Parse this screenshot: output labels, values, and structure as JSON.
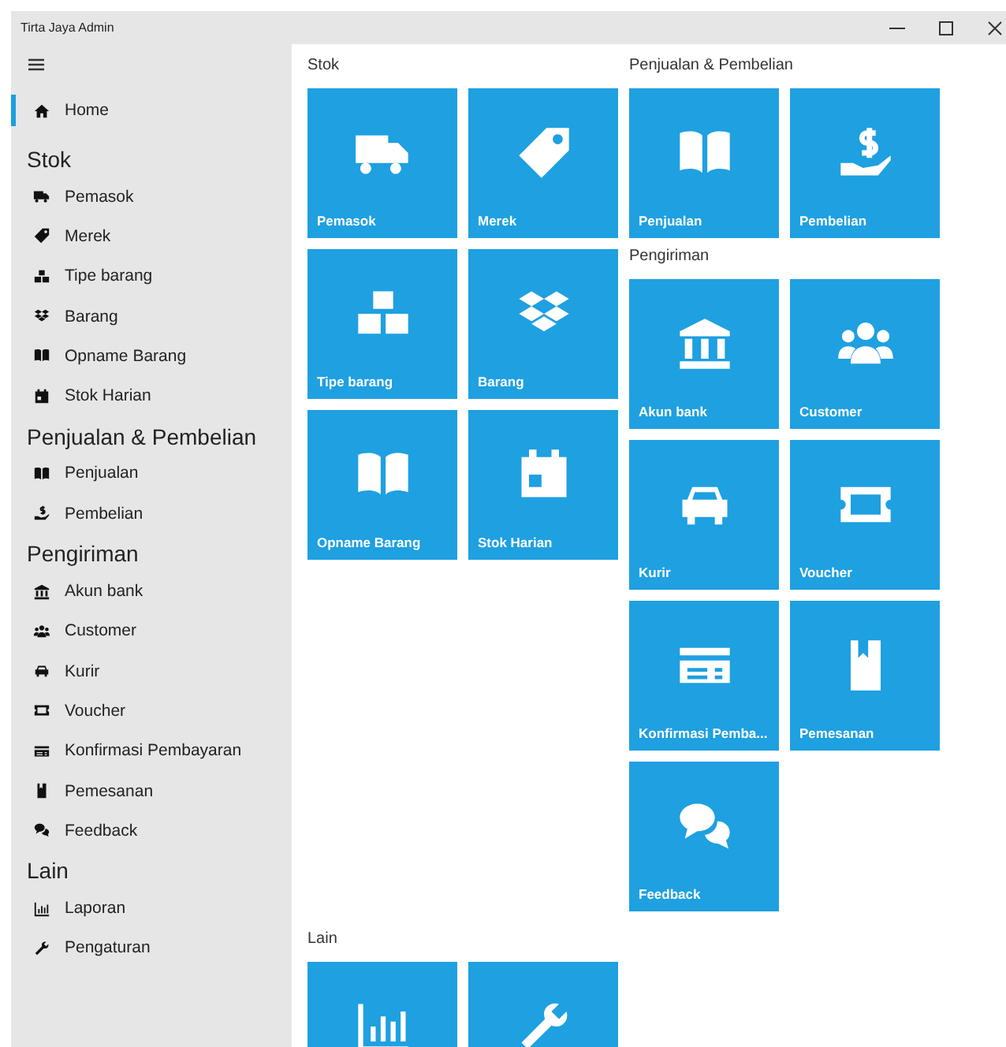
{
  "window": {
    "title": "Tirta Jaya Admin"
  },
  "sidebar": {
    "home": {
      "label": "Home",
      "selected": true
    },
    "sections": [
      {
        "title": "Stok",
        "items": [
          {
            "label": "Pemasok",
            "selected": false
          },
          {
            "label": "Merek",
            "selected": false
          },
          {
            "label": "Tipe barang",
            "selected": false
          },
          {
            "label": "Barang",
            "selected": false
          },
          {
            "label": "Opname Barang",
            "selected": false
          },
          {
            "label": "Stok Harian",
            "selected": false
          }
        ]
      },
      {
        "title": "Penjualan & Pembelian",
        "items": [
          {
            "label": "Penjualan",
            "selected": false
          },
          {
            "label": "Pembelian",
            "selected": false
          }
        ]
      },
      {
        "title": "Pengiriman",
        "items": [
          {
            "label": "Akun bank",
            "selected": false
          },
          {
            "label": "Customer",
            "selected": false
          },
          {
            "label": "Kurir",
            "selected": false
          },
          {
            "label": "Voucher",
            "selected": false
          },
          {
            "label": "Konfirmasi Pembayaran",
            "selected": false
          },
          {
            "label": "Pemesanan",
            "selected": false
          },
          {
            "label": "Feedback",
            "selected": false
          }
        ]
      },
      {
        "title": "Lain",
        "items": [
          {
            "label": "Laporan",
            "selected": false
          },
          {
            "label": "Pengaturan",
            "selected": false
          }
        ]
      }
    ]
  },
  "tiles": {
    "sections": [
      {
        "title": "Stok",
        "tiles": [
          {
            "label": "Pemasok"
          },
          {
            "label": "Merek"
          },
          {
            "label": "Tipe barang"
          },
          {
            "label": "Barang"
          },
          {
            "label": "Opname Barang"
          },
          {
            "label": "Stok Harian"
          }
        ]
      },
      {
        "title": "Penjualan & Pembelian",
        "tiles": [
          {
            "label": "Penjualan"
          },
          {
            "label": "Pembelian"
          }
        ]
      },
      {
        "title": "Pengiriman",
        "tiles": [
          {
            "label": "Akun bank"
          },
          {
            "label": "Customer"
          },
          {
            "label": "Kurir"
          },
          {
            "label": "Voucher"
          },
          {
            "label": "Konfirmasi Pemba..."
          },
          {
            "label": "Pemesanan"
          },
          {
            "label": "Feedback"
          }
        ]
      },
      {
        "title": "Lain",
        "tiles": [
          {
            "kind": "tile"
          },
          {
            "kind": "tile"
          }
        ]
      }
    ]
  }
}
